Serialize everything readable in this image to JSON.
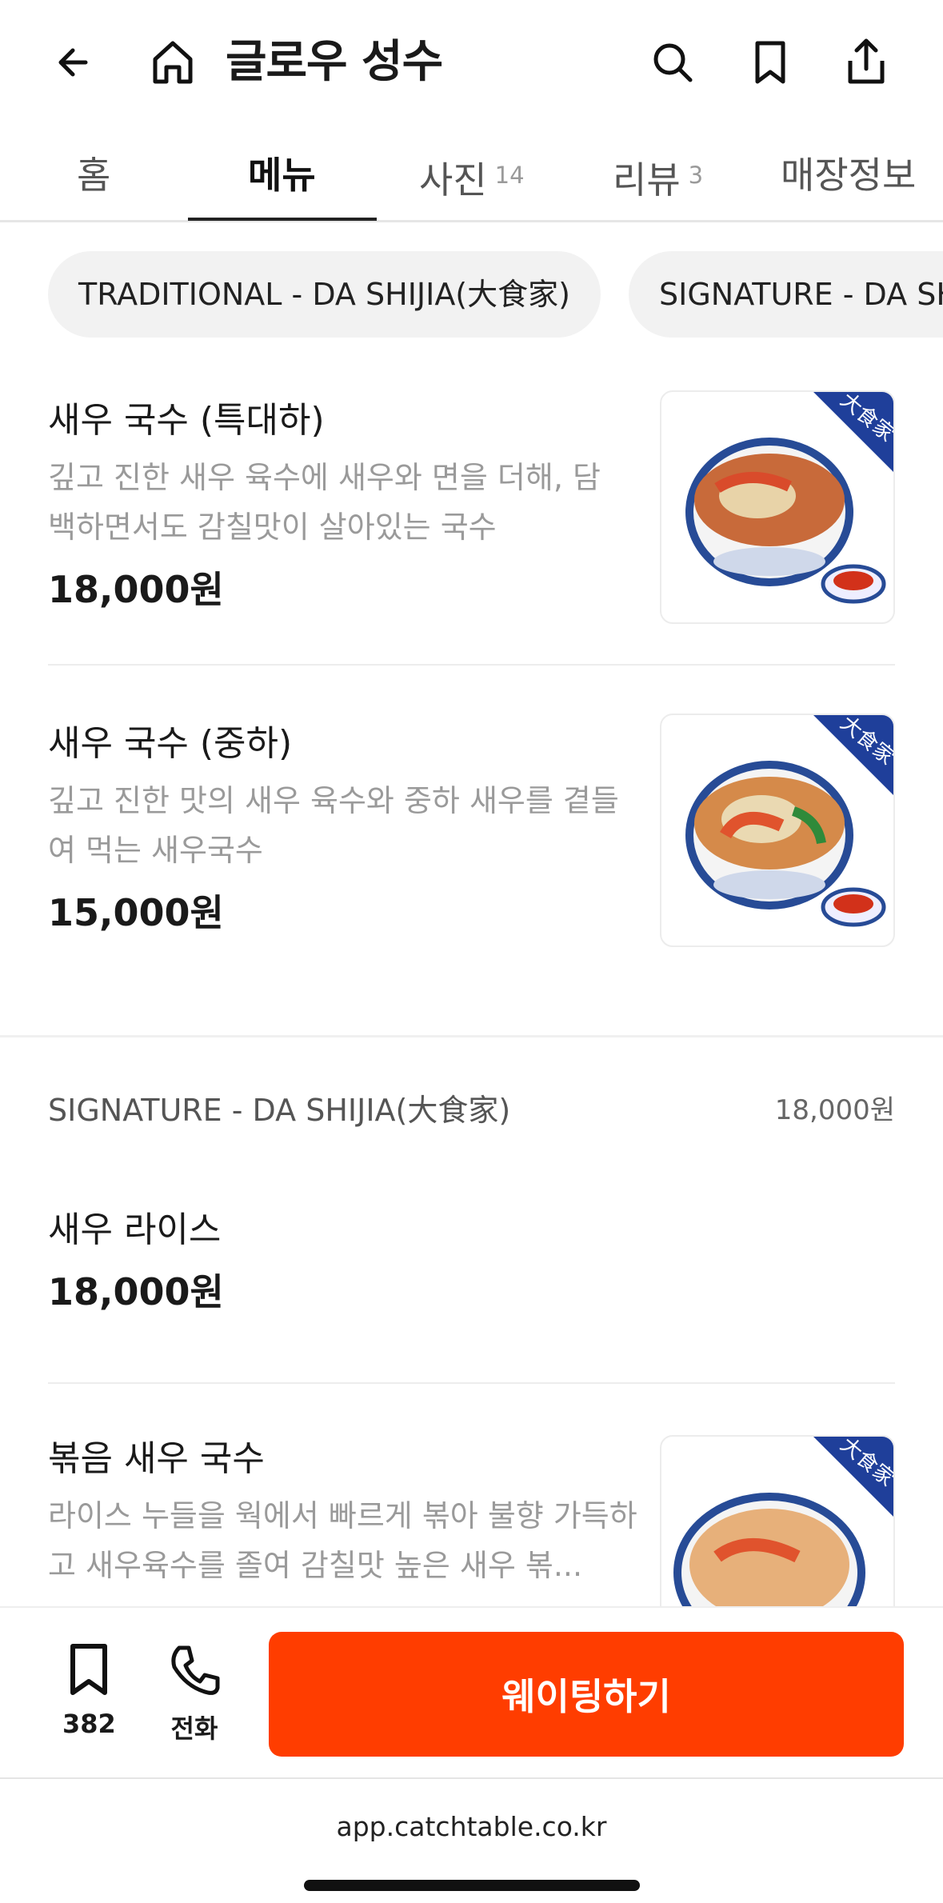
{
  "header": {
    "title": "글로우 성수",
    "icons": [
      "back-arrow-icon",
      "home-icon",
      "search-icon",
      "bookmark-icon",
      "share-icon"
    ]
  },
  "tabs": [
    {
      "label": "홈",
      "count": ""
    },
    {
      "label": "메뉴",
      "count": "",
      "active": true
    },
    {
      "label": "사진",
      "count": "14"
    },
    {
      "label": "리뷰",
      "count": "3"
    },
    {
      "label": "매장정보",
      "count": ""
    }
  ],
  "chips": [
    "TRADITIONAL - DA SHIJIA(大食家)",
    "SIGNATURE - DA SHIJIA(大食家)"
  ],
  "menu_items": [
    {
      "name": "새우 국수 (특대하)",
      "desc": "깊고 진한 새우 육수에 새우와 면을 더해, 담백하면서도 감칠맛이 살아있는 국수",
      "price": "18,000원"
    },
    {
      "name": "새우 국수 (중하)",
      "desc": "깊고 진한 맛의 새우 육수와 중하 새우를 곁들여 먹는 새우국수",
      "price": "15,000원"
    }
  ],
  "section": {
    "title": "SIGNATURE - DA SHIJIA(大食家)",
    "price": "18,000원"
  },
  "section_items": [
    {
      "name": "새우 라이스",
      "price": "18,000원"
    },
    {
      "name": "볶음 새우 국수",
      "desc": "라이스 누들을 웍에서 빠르게 볶아 불향 가득하고 새우육수를 졸여 감칠맛 높은 새우 볶..."
    }
  ],
  "thumb_badge": "大食家",
  "bottom": {
    "bookmark_count": "382",
    "call_label": "전화",
    "wait_label": "웨이팅하기"
  },
  "browser": {
    "url": "app.catchtable.co.kr"
  },
  "colors": {
    "accent": "#ff3d00",
    "badge_blue": "#1f3f9a"
  }
}
